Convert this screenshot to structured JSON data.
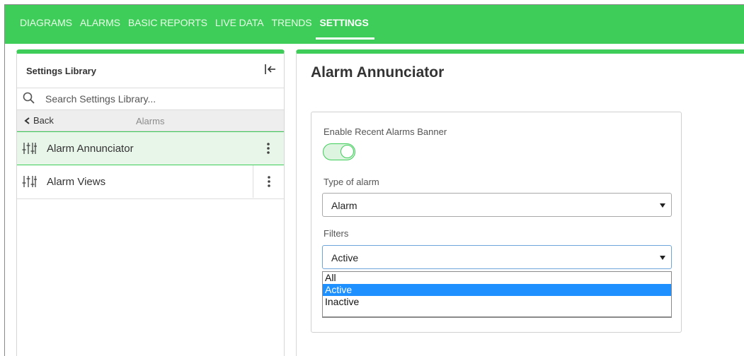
{
  "nav": {
    "tabs": [
      {
        "label": "DIAGRAMS"
      },
      {
        "label": "ALARMS"
      },
      {
        "label": "BASIC REPORTS"
      },
      {
        "label": "LIVE DATA"
      },
      {
        "label": "TRENDS"
      },
      {
        "label": "SETTINGS",
        "active": true
      }
    ]
  },
  "library": {
    "title": "Settings Library",
    "search_placeholder": "Search Settings Library...",
    "back_label": "Back",
    "breadcrumb": "Alarms",
    "items": [
      {
        "label": "Alarm Annunciator",
        "icon": "sliders-icon",
        "active": true
      },
      {
        "label": "Alarm Views",
        "icon": "sliders-icon"
      }
    ]
  },
  "page": {
    "title": "Alarm Annunciator",
    "banner_toggle_label": "Enable Recent Alarms Banner",
    "banner_enabled": true,
    "type_label": "Type of alarm",
    "type_value": "Alarm",
    "filters_label": "Filters",
    "filters_value": "Active",
    "filter_options": [
      "All",
      "Active",
      "Inactive"
    ],
    "filter_selected_index": 1
  },
  "colors": {
    "accent": "#3dcd58",
    "selection": "#1e90ff",
    "active_row": "#e8f5e9"
  }
}
